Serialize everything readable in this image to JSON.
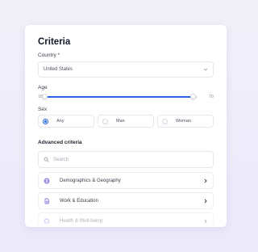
{
  "card": {
    "title": "Criteria"
  },
  "country": {
    "label": "Country",
    "required_mark": "*",
    "value": "United States"
  },
  "age": {
    "label": "Age",
    "min_label": "18",
    "max_label": "70",
    "range_low_fraction": 0.0,
    "range_high_fraction": 0.97
  },
  "sex": {
    "label": "Sex",
    "options": [
      {
        "label": "Any",
        "selected": true
      },
      {
        "label": "Man",
        "selected": false
      },
      {
        "label": "Woman",
        "selected": false
      }
    ]
  },
  "advanced": {
    "heading": "Advanced criteria",
    "search_placeholder": "Search",
    "categories": [
      {
        "label": "Demographics & Geography",
        "icon": "globe-icon"
      },
      {
        "label": "Work & Education",
        "icon": "document-icon"
      },
      {
        "label": "Health & Well-being",
        "icon": "smile-icon"
      }
    ]
  },
  "colors": {
    "accent": "#2563eb",
    "icon_purple": "#6d4fd8",
    "background": "#efeefa"
  }
}
